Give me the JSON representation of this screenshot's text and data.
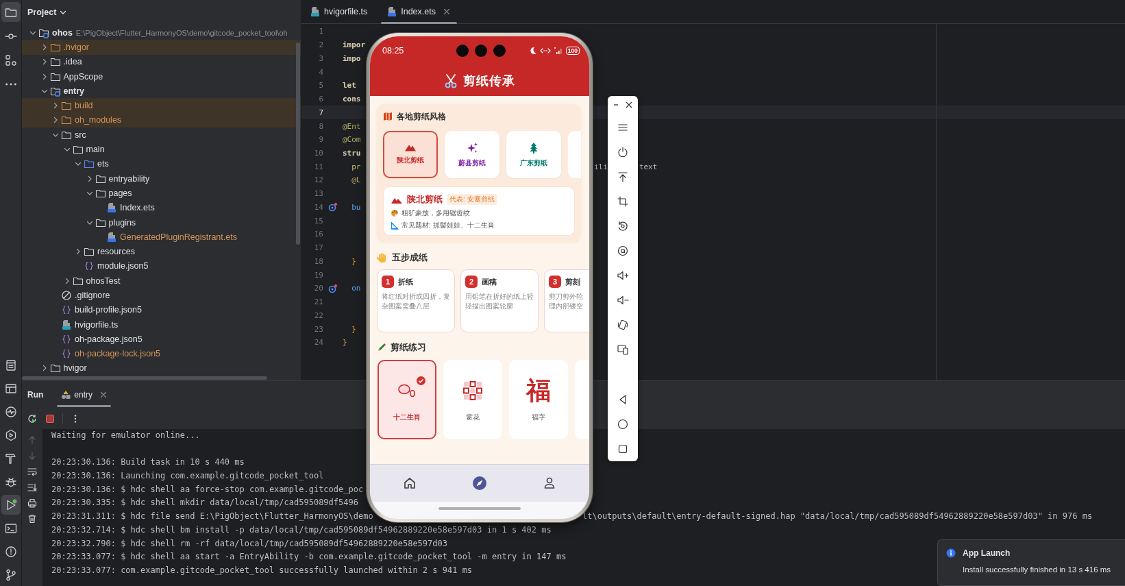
{
  "activity_bar": {
    "top": [
      {
        "kind": "project",
        "selected": true
      },
      {
        "kind": "commit",
        "selected": false
      },
      {
        "kind": "structure",
        "selected": false
      },
      {
        "kind": "more",
        "selected": false
      }
    ],
    "bottom": [
      {
        "kind": "todo",
        "selected": false
      },
      {
        "kind": "layout",
        "selected": false
      },
      {
        "kind": "profiler",
        "selected": false
      },
      {
        "kind": "services",
        "selected": false
      },
      {
        "kind": "build",
        "selected": false
      },
      {
        "kind": "debug",
        "selected": false
      },
      {
        "kind": "run",
        "selected": true
      },
      {
        "kind": "terminal",
        "selected": false
      },
      {
        "kind": "problems",
        "selected": false
      },
      {
        "kind": "git",
        "selected": false
      }
    ]
  },
  "project_panel": {
    "title": "Project",
    "tree": [
      {
        "name": "ohos",
        "kind": "module",
        "excluded": false,
        "ignored": false,
        "expanded": true,
        "path": "E:\\PigObject\\Flutter_HarmonyOS\\demo\\gitcode_pocket_tool\\oh",
        "children": [
          {
            "name": ".hvigor",
            "kind": "folder",
            "excluded": true,
            "ignored": false,
            "expanded": false
          },
          {
            "name": ".idea",
            "kind": "folder",
            "excluded": false,
            "ignored": false,
            "expanded": false
          },
          {
            "name": "AppScope",
            "kind": "folder",
            "excluded": false,
            "ignored": false,
            "expanded": false
          },
          {
            "name": "entry",
            "kind": "module",
            "excluded": false,
            "ignored": false,
            "expanded": true,
            "children": [
              {
                "name": "build",
                "kind": "folder",
                "excluded": true,
                "ignored": false,
                "expanded": false
              },
              {
                "name": "oh_modules",
                "kind": "folder",
                "excluded": true,
                "ignored": false,
                "expanded": false
              },
              {
                "name": "src",
                "kind": "folder",
                "excluded": false,
                "ignored": false,
                "expanded": true,
                "children": [
                  {
                    "name": "main",
                    "kind": "folder",
                    "excluded": false,
                    "ignored": false,
                    "expanded": true,
                    "children": [
                      {
                        "name": "ets",
                        "kind": "source-folder",
                        "excluded": false,
                        "ignored": false,
                        "expanded": true,
                        "children": [
                          {
                            "name": "entryability",
                            "kind": "folder",
                            "excluded": false,
                            "ignored": false,
                            "expanded": false
                          },
                          {
                            "name": "pages",
                            "kind": "folder",
                            "excluded": false,
                            "ignored": false,
                            "expanded": true,
                            "children": [
                              {
                                "name": "Index.ets",
                                "kind": "ets-file",
                                "excluded": false,
                                "ignored": false
                              }
                            ]
                          },
                          {
                            "name": "plugins",
                            "kind": "folder",
                            "excluded": false,
                            "ignored": false,
                            "expanded": true,
                            "children": [
                              {
                                "name": "GeneratedPluginRegistrant.ets",
                                "kind": "ets-file",
                                "excluded": false,
                                "ignored": true
                              }
                            ]
                          }
                        ]
                      },
                      {
                        "name": "resources",
                        "kind": "folder",
                        "excluded": false,
                        "ignored": false,
                        "expanded": false
                      },
                      {
                        "name": "module.json5",
                        "kind": "json-file",
                        "excluded": false,
                        "ignored": false
                      }
                    ]
                  },
                  {
                    "name": "ohosTest",
                    "kind": "folder",
                    "excluded": false,
                    "ignored": false,
                    "expanded": false
                  }
                ]
              },
              {
                "name": ".gitignore",
                "kind": "ignore-file",
                "excluded": false,
                "ignored": false
              },
              {
                "name": "build-profile.json5",
                "kind": "json-file",
                "excluded": false,
                "ignored": false
              },
              {
                "name": "hvigorfile.ts",
                "kind": "ts-file",
                "excluded": false,
                "ignored": false
              },
              {
                "name": "oh-package.json5",
                "kind": "json-file",
                "excluded": false,
                "ignored": false
              },
              {
                "name": "oh-package-lock.json5",
                "kind": "json-file",
                "excluded": false,
                "ignored": true
              }
            ]
          },
          {
            "name": "hvigor",
            "kind": "folder",
            "excluded": false,
            "ignored": false,
            "expanded": false
          }
        ]
      }
    ]
  },
  "editor": {
    "tabs": [
      {
        "label": "hvigorfile.ts",
        "kind": "ts",
        "selected": false
      },
      {
        "label": "Index.ets",
        "kind": "ets",
        "selected": true
      }
    ],
    "lines": [
      {
        "number": "1",
        "current": false,
        "marker": false
      },
      {
        "number": "2",
        "current": false,
        "marker": false,
        "tokens": [
          {
            "text": "impor",
            "kind": "keyword"
          }
        ]
      },
      {
        "number": "3",
        "current": false,
        "marker": false,
        "tokens": [
          {
            "text": "impo",
            "kind": "keyword"
          }
        ]
      },
      {
        "number": "4",
        "current": false,
        "marker": false
      },
      {
        "number": "5",
        "current": false,
        "marker": false,
        "tokens": [
          {
            "text": "let",
            "kind": "keyword"
          }
        ]
      },
      {
        "number": "6",
        "current": false,
        "marker": false,
        "tokens": [
          {
            "text": "cons",
            "kind": "keyword"
          }
        ]
      },
      {
        "number": "7",
        "current": true,
        "marker": false
      },
      {
        "number": "8",
        "current": false,
        "marker": false,
        "tokens": [
          {
            "text": "@Ent",
            "kind": "annotation"
          }
        ]
      },
      {
        "number": "9",
        "current": false,
        "marker": false,
        "tokens": [
          {
            "text": "@Com",
            "kind": "annotation"
          }
        ]
      },
      {
        "number": "10",
        "current": false,
        "marker": false,
        "tokens": [
          {
            "text": "stru",
            "kind": "keyword"
          }
        ]
      },
      {
        "number": "11",
        "current": false,
        "marker": false,
        "tokens": [
          {
            "text": "  pr",
            "kind": "property"
          }
        ],
        "tail": [
          {
            "text": "ili",
            "kind": "plain"
          },
          {
            "text": "text",
            "kind": "plain"
          }
        ]
      },
      {
        "number": "12",
        "current": false,
        "marker": false,
        "tokens": [
          {
            "text": "  @L",
            "kind": "annotation"
          }
        ]
      },
      {
        "number": "13",
        "current": false,
        "marker": false
      },
      {
        "number": "14",
        "current": false,
        "marker": true,
        "tokens": [
          {
            "text": "  bu",
            "kind": "method"
          }
        ]
      },
      {
        "number": "15",
        "current": false,
        "marker": false
      },
      {
        "number": "16",
        "current": false,
        "marker": false
      },
      {
        "number": "17",
        "current": false,
        "marker": false
      },
      {
        "number": "18",
        "current": false,
        "marker": false,
        "tokens": [
          {
            "text": "  }",
            "kind": "brace"
          }
        ]
      },
      {
        "number": "19",
        "current": false,
        "marker": false
      },
      {
        "number": "20",
        "current": false,
        "marker": true,
        "tokens": [
          {
            "text": "  on",
            "kind": "method"
          }
        ]
      },
      {
        "number": "21",
        "current": false,
        "marker": false
      },
      {
        "number": "22",
        "current": false,
        "marker": false
      },
      {
        "number": "23",
        "current": false,
        "marker": false,
        "tokens": [
          {
            "text": "  }",
            "kind": "brace"
          }
        ]
      },
      {
        "number": "24",
        "current": false,
        "marker": false,
        "tokens": [
          {
            "text": "}",
            "kind": "brace"
          }
        ]
      }
    ]
  },
  "run_panel": {
    "title": "Run",
    "tabs": [
      {
        "label": "entry",
        "selected": true
      }
    ],
    "console": [
      {
        "kind": "output",
        "text": "Waiting for emulator online..."
      },
      {
        "kind": "blank"
      },
      {
        "kind": "output",
        "text": "20:23:30.136: Build task in 10 s 440 ms"
      },
      {
        "kind": "output",
        "text": "20:23:30.136: Launching com.example.gitcode_pocket_tool"
      },
      {
        "kind": "output",
        "text": "20:23:30.136: $ hdc shell aa force-stop com.example.gitcode_poc"
      },
      {
        "kind": "output",
        "text": "20:23:30.335: $ hdc shell mkdir data/local/tmp/cad595089df5496"
      },
      {
        "kind": "output",
        "text": "20:23:31.311: $ hdc file send E:\\PigObject\\Flutter_HarmonyOS\\demo",
        "tail": "lt\\outputs\\default\\entry-default-signed.hap \"data/local/tmp/cad595089df54962889220e58e597d03\" in 976 ms"
      },
      {
        "kind": "output",
        "text": "20:23:32.714: $ hdc shell bm install -p data/local/tmp/cad595089df54962889220e58e597d03 in 1 s 402 ms"
      },
      {
        "kind": "output",
        "text": "20:23:32.790: $ hdc shell rm -rf data/local/tmp/cad595089df54962889220e58e597d03"
      },
      {
        "kind": "output",
        "text": "20:23:33.077: $ hdc shell aa start -a EntryAbility -b com.example.gitcode_pocket_tool -m entry in 147 ms"
      },
      {
        "kind": "output",
        "text": "20:23:33.077: com.example.gitcode_pocket_tool successfully launched within 2 s 941 ms"
      }
    ]
  },
  "notification": {
    "title": "App Launch",
    "message": "Install successfully finished in 13 s 416 ms"
  },
  "phone": {
    "status_bar": {
      "time": "08:25",
      "battery": "100"
    },
    "app_bar": {
      "title": "剪纸传承"
    },
    "styles": {
      "title": "各地剪纸风格",
      "regions": [
        {
          "name": "陕北剪纸",
          "kind": "mountain",
          "color": "#c62828",
          "selected": true
        },
        {
          "name": "蔚县剪纸",
          "kind": "sparkle",
          "color": "#7b1fa2",
          "selected": false
        },
        {
          "name": "广东剪纸",
          "kind": "tree",
          "color": "#00796b",
          "selected": false
        }
      ],
      "detail": {
        "name": "陕北剪纸",
        "badge": "代表: 安塞剪纸",
        "facts": [
          {
            "kind": "palette",
            "text": "粗犷豪放，多用锯齿纹"
          },
          {
            "kind": "ruler",
            "text": "常见题材: 抓髻娃娃、十二生肖"
          }
        ]
      }
    },
    "steps": {
      "title": "五步成纸",
      "items": [
        {
          "number": "1",
          "title": "折纸",
          "lines": [
            "将红纸对折或四折，复",
            "杂图案需叠八层"
          ]
        },
        {
          "number": "2",
          "title": "画稿",
          "lines": [
            "用铅笔在折好的纸上轻",
            "轻描出图案轮廓"
          ]
        },
        {
          "number": "3",
          "title": "剪刻",
          "lines": [
            "剪刀剪外轮",
            "理内部镂空"
          ]
        }
      ]
    },
    "practice": {
      "title": "剪纸练习",
      "items": [
        {
          "label": "十二生肖",
          "kind": "zodiac",
          "selected": true
        },
        {
          "label": "窗花",
          "kind": "window",
          "selected": false
        },
        {
          "label": "福字",
          "kind": "glyph",
          "glyph": "福",
          "selected": false
        }
      ]
    },
    "bottom_nav": [
      {
        "kind": "home",
        "selected": false
      },
      {
        "kind": "discover",
        "selected": true
      },
      {
        "kind": "profile",
        "selected": false
      }
    ]
  }
}
